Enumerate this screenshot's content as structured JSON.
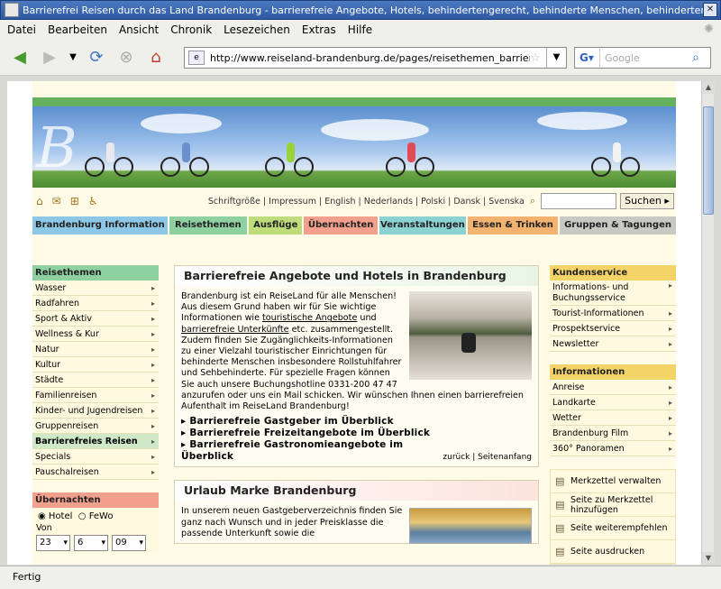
{
  "window": {
    "title": "Barrierefrei Reisen durch das Land Brandenburg - barrierefreie Angebote, Hotels, behindertengerecht, behinderte Menschen, behindertenge"
  },
  "menu": [
    "Datei",
    "Bearbeiten",
    "Ansicht",
    "Chronik",
    "Lesezeichen",
    "Extras",
    "Hilfe"
  ],
  "nav": {
    "url": "http://www.reiseland-brandenburg.de/pages/reisethemen_barriere.",
    "search_placeholder": "Google"
  },
  "status": "Fertig",
  "toplinks": "Schriftgröße | Impressum | English | Nederlands | Polski | Dansk | Svenska",
  "search_button": "Suchen",
  "tabs": [
    {
      "label": "Brandenburg Information",
      "color": "#8cc8e6"
    },
    {
      "label": "Reisethemen",
      "color": "#8fd0a0"
    },
    {
      "label": "Ausflüge",
      "color": "#bedc7c"
    },
    {
      "label": "Übernachten",
      "color": "#f2a08e"
    },
    {
      "label": "Veranstaltungen",
      "color": "#8dd2d2"
    },
    {
      "label": "Essen & Trinken",
      "color": "#f2b270"
    },
    {
      "label": "Gruppen & Tagungen",
      "color": "#c9c9c4"
    }
  ],
  "left": {
    "head": "Reisethemen",
    "items": [
      "Wasser",
      "Radfahren",
      "Sport & Aktiv",
      "Wellness & Kur",
      "Natur",
      "Kultur",
      "Städte",
      "Familienreisen",
      "Kinder- und Jugendreisen",
      "Gruppenreisen",
      "Barrierefreies Reisen",
      "Specials",
      "Pauschalreisen"
    ],
    "booking": {
      "head": "Übernachten",
      "opt1": "Hotel",
      "opt2": "FeWo",
      "von": "Von",
      "day": "23",
      "month": "6",
      "year": "09"
    }
  },
  "main": {
    "title": "Barrierefreie Angebote und Hotels in Brandenburg",
    "p1": "Brandenburg ist ein ReiseLand für alle Menschen! Aus diesem Grund haben wir für Sie wichtige Informationen wie ",
    "link1": "touristische Angebote",
    "p1b": " und ",
    "link2": "barrierefreie Unterkünfte",
    "p2": " etc. zusammengestellt. Zudem finden Sie Zugänglichkeits-Informationen zu einer Vielzahl touristischer Einrichtungen für behinderte Menschen insbesondere Rollstuhlfahrer und Sehbehinderte. Für spezielle Fragen können Sie auch unsere Buchungshotline 0331-200 47 47 anzurufen oder uns ein Mail schicken. Wir wünschen Ihnen einen barrierefreien Aufenthalt im ReiseLand Brandenburg!",
    "bullets": [
      "Barrierefreie Gastgeber im Überblick",
      "Barrierefreie Freizeitangebote im Überblick",
      "Barrierefreie Gastronomieangebote im Überblick"
    ],
    "footer": "zurück | Seitenanfang",
    "card2_title": "Urlaub Marke Brandenburg",
    "card2_text": "In unserem neuen Gastgeberverzeichnis finden Sie ganz nach Wunsch und in jeder Preisklasse die passende Unterkunft sowie die"
  },
  "right": {
    "service_head": "Kundenservice",
    "service": [
      "Informations- und Buchungsservice",
      "Tourist-Informationen",
      "Prospektservice",
      "Newsletter"
    ],
    "info_head": "Informationen",
    "info": [
      "Anreise",
      "Landkarte",
      "Wetter",
      "Brandenburg Film",
      "360° Panoramen"
    ],
    "tools": [
      "Merkzettel verwalten",
      "Seite zu Merkzettel hinzufügen",
      "Seite weiterempfehlen",
      "Seite ausdrucken"
    ]
  },
  "colors": {
    "green": "#64b25f",
    "service_head": "#f5d467",
    "booking_head": "#f2a08e"
  }
}
